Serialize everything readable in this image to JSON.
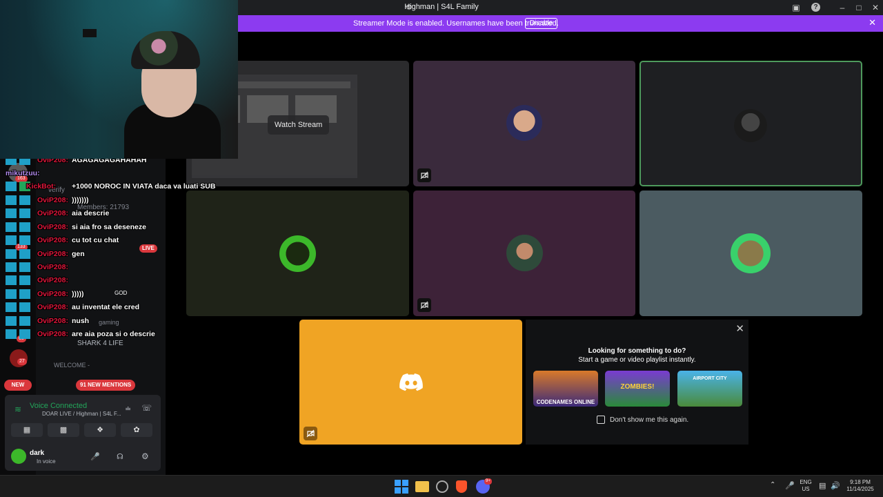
{
  "window": {
    "title": "Highman | S4L Family",
    "minimize_icon": "minimize-icon",
    "maximize_icon": "maximize-icon",
    "close_icon": "close-icon"
  },
  "banner": {
    "text": "Streamer Mode is enabled. Usernames have been truncated.",
    "button": "Disable"
  },
  "stage": {
    "watch_stream": "Watch Stream"
  },
  "activity": {
    "title": "Looking for something to do?",
    "subtitle": "Start a game or video playlist instantly.",
    "games": [
      "CODENAMES ONLINE",
      "ZOMBIES!",
      "AIRPORT CITY"
    ],
    "dont_show": "Don't show me this again."
  },
  "channels": {
    "verify": "verify",
    "members": "Members: 21793",
    "live_badge": "LIVE",
    "god_tag": "GOD",
    "shark": "SHARK 4 LIFE",
    "welcome": "WELCOME -",
    "gaming": "gaming"
  },
  "sidebar": {
    "badge_163": "163",
    "badge_133": "133",
    "badge_65": "65",
    "badge_27": "27",
    "new_label": "NEW",
    "mentions": "91 NEW MENTIONS"
  },
  "voice": {
    "status": "Voice Connected",
    "channel": "DOAR LIVE / Highman | S4L F..."
  },
  "user": {
    "name": "dark",
    "status": "In voice"
  },
  "chat": [
    {
      "user": "OviP208:",
      "msg": "AGAGAGAGAHAHAH"
    },
    {
      "user": "mikutzuu:",
      "msg": ""
    },
    {
      "user": "KickBot:",
      "msg": "+1000 NOROC IN VIATA daca va luati SUB"
    },
    {
      "user": "OviP208:",
      "msg": ")))))))"
    },
    {
      "user": "OviP208:",
      "msg": "aia descrie"
    },
    {
      "user": "OviP208:",
      "msg": "si aia fro sa deseneze"
    },
    {
      "user": "OviP208:",
      "msg": "cu tot cu chat"
    },
    {
      "user": "OviP208:",
      "msg": "gen"
    },
    {
      "user": "OviP208:",
      "msg": ""
    },
    {
      "user": "OviP208:",
      "msg": ""
    },
    {
      "user": "OviP208:",
      "msg": ")))))"
    },
    {
      "user": "OviP208:",
      "msg": "au inventat ele cred"
    },
    {
      "user": "OviP208:",
      "msg": "nush"
    },
    {
      "user": "OviP208:",
      "msg": "are aia poza si o descrie"
    }
  ],
  "taskbar": {
    "lang1": "ENG",
    "lang2": "US",
    "time": "9:18 PM",
    "date": "11/14/2025",
    "notif_badge": "9+"
  },
  "colors": {
    "banner": "#8c3bf0",
    "stage_tile_dark": "#2b2b2d",
    "tile_purple": "#3a2a3c",
    "tile_olive": "#1f2318",
    "tile_plum": "#3d2238",
    "tile_slate": "#4b5b61",
    "discord_orange": "#f0a424",
    "speaking_border": "#4e9a5c",
    "chat_user_red": "#e0163b"
  }
}
